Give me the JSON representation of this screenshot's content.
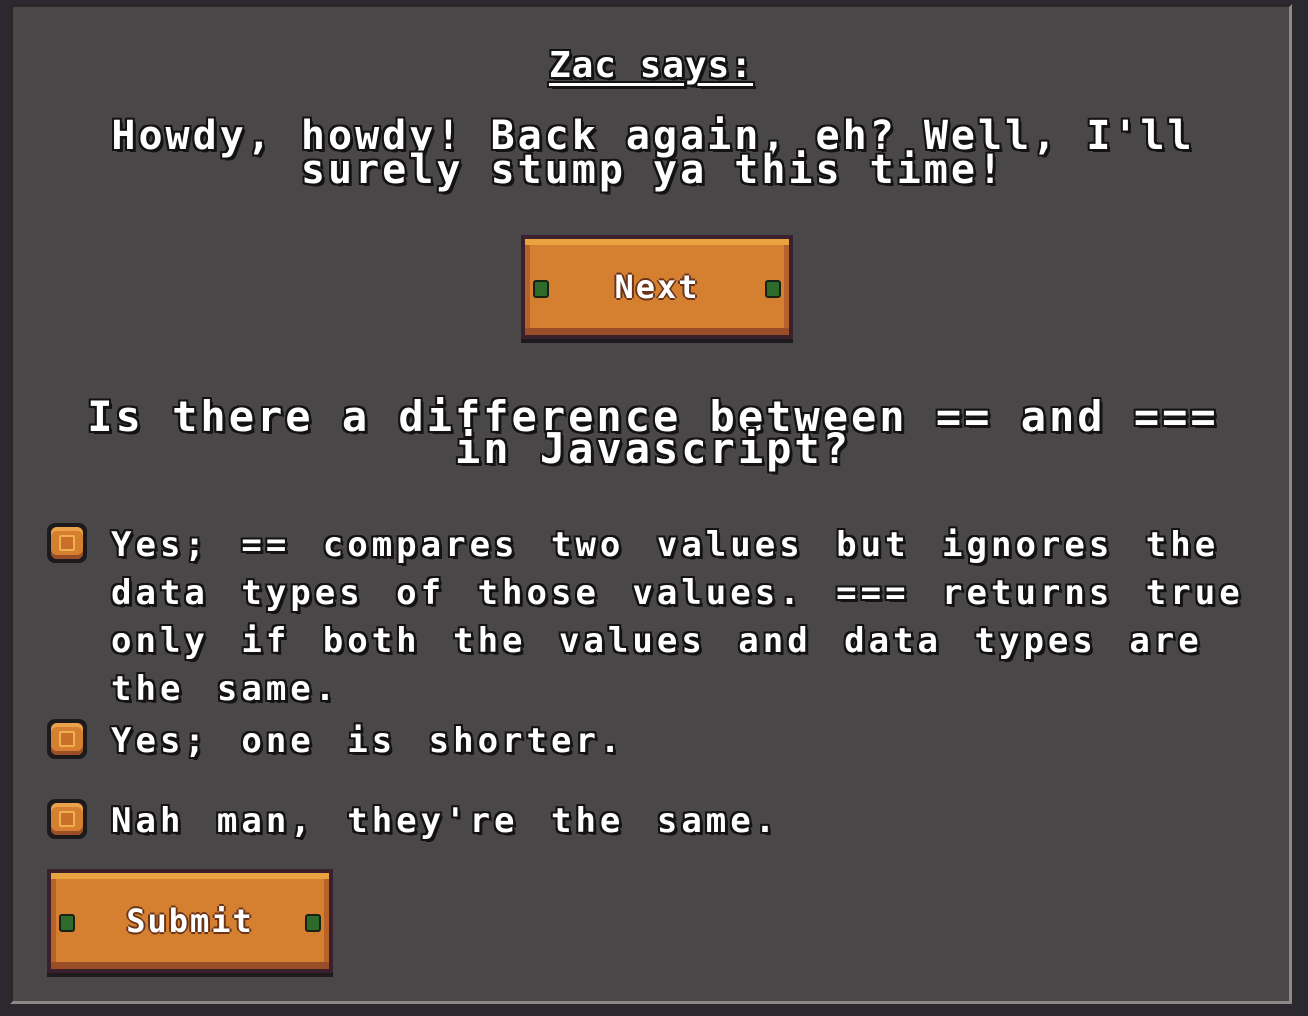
{
  "dialog": {
    "speaker": "Zac says:",
    "message": "Howdy, howdy! Back again, eh? Well, I'll surely stump ya this time!"
  },
  "buttons": {
    "next_label": "Next",
    "submit_label": "Submit"
  },
  "quiz": {
    "question": "Is there a difference between == and === in Javascript?",
    "options": [
      {
        "label": "Yes; == compares two values but ignores the data types of those values. === returns true only if both the values and data types are the same."
      },
      {
        "label": "Yes; one is shorter."
      },
      {
        "label": "Nah man, they're the same."
      }
    ]
  },
  "colors": {
    "panel_bg": "#4a4749",
    "wood": "#d57f31",
    "wood_border": "#3a1f2c",
    "nail": "#2e6a2a",
    "text": "#ffffff"
  },
  "icons": {
    "radio": "radio-button-icon",
    "nail": "nail-icon"
  }
}
